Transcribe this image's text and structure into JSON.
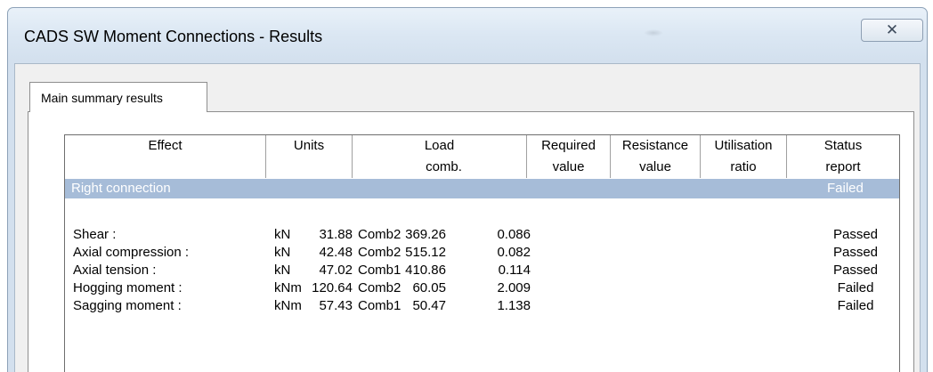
{
  "window": {
    "title": "CADS SW Moment Connections - Results",
    "close_glyph": "✕"
  },
  "tabs": [
    {
      "label": "Main summary results",
      "active": true
    }
  ],
  "table": {
    "columns": [
      {
        "line1": "Effect",
        "line2": ""
      },
      {
        "line1": "Units",
        "line2": ""
      },
      {
        "line1": "Load",
        "line2": "comb."
      },
      {
        "line1": "Required",
        "line2": "value"
      },
      {
        "line1": "Resistance",
        "line2": "value"
      },
      {
        "line1": "Utilisation",
        "line2": "ratio"
      },
      {
        "line1": "Status",
        "line2": "report"
      }
    ],
    "group": {
      "name": "Right connection",
      "status": "Failed"
    },
    "rows": [
      {
        "effect": "Shear :",
        "units": "kN",
        "load": "Comb2",
        "required": "31.88",
        "resistance": "369.26",
        "utilisation": "0.086",
        "status": "Passed"
      },
      {
        "effect": "Axial compression :",
        "units": "kN",
        "load": "Comb2",
        "required": "42.48",
        "resistance": "515.12",
        "utilisation": "0.082",
        "status": "Passed"
      },
      {
        "effect": "Axial tension :",
        "units": "kN",
        "load": "Comb1",
        "required": "47.02",
        "resistance": "410.86",
        "utilisation": "0.114",
        "status": "Passed"
      },
      {
        "effect": "Hogging moment :",
        "units": "kNm",
        "load": "Comb2",
        "required": "120.64",
        "resistance": "60.05",
        "utilisation": "2.009",
        "status": "Failed"
      },
      {
        "effect": "Sagging moment :",
        "units": "kNm",
        "load": "Comb1",
        "required": "57.43",
        "resistance": "50.47",
        "utilisation": "1.138",
        "status": "Failed"
      }
    ]
  },
  "colors": {
    "selection_row": "#a6bcd8",
    "window_frame": "#d3e0ee"
  }
}
